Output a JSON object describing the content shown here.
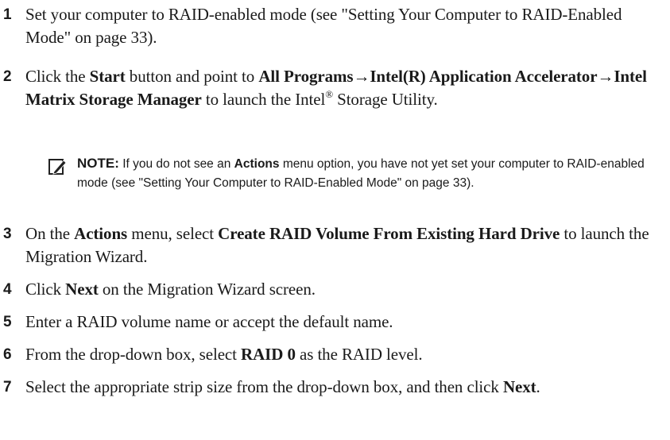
{
  "steps": [
    {
      "num": "1",
      "parts": [
        {
          "t": "Set your computer to RAID-enabled mode (see \"Setting Your Computer to RAID-Enabled Mode\" on page 33)."
        }
      ]
    },
    {
      "num": "2",
      "parts": [
        {
          "t": "Click the "
        },
        {
          "t": "Start",
          "b": true
        },
        {
          "t": " button and point to "
        },
        {
          "t": "All Programs→Intel(R) Application Accelerator→Intel Matrix Storage Manager",
          "b": true
        },
        {
          "t": " to launch the Intel"
        },
        {
          "t": "®",
          "sup": true
        },
        {
          "t": " Storage Utility."
        }
      ]
    },
    {
      "num": "3",
      "parts": [
        {
          "t": "On the "
        },
        {
          "t": "Actions",
          "b": true
        },
        {
          "t": " menu, select "
        },
        {
          "t": "Create RAID Volume From Existing Hard Drive",
          "b": true
        },
        {
          "t": " to launch the Migration Wizard."
        }
      ]
    },
    {
      "num": "4",
      "parts": [
        {
          "t": "Click "
        },
        {
          "t": "Next",
          "b": true
        },
        {
          "t": " on the Migration Wizard screen."
        }
      ]
    },
    {
      "num": "5",
      "parts": [
        {
          "t": "Enter a RAID volume name or accept the default name."
        }
      ]
    },
    {
      "num": "6",
      "parts": [
        {
          "t": "From the drop-down box, select "
        },
        {
          "t": "RAID 0",
          "b": true
        },
        {
          "t": " as the RAID level."
        }
      ]
    },
    {
      "num": "7",
      "parts": [
        {
          "t": "Select the appropriate strip size from the drop-down box, and then click "
        },
        {
          "t": "Next",
          "b": true
        },
        {
          "t": "."
        }
      ]
    }
  ],
  "note": {
    "icon": "pencil-note-icon",
    "label": "NOTE:",
    "parts": [
      {
        "t": " If you do not see an "
      },
      {
        "t": "Actions",
        "b": true
      },
      {
        "t": " menu option, you have not yet set your computer to RAID-enabled mode (see \"Setting Your Computer to RAID-Enabled Mode\" on page 33)."
      }
    ]
  }
}
